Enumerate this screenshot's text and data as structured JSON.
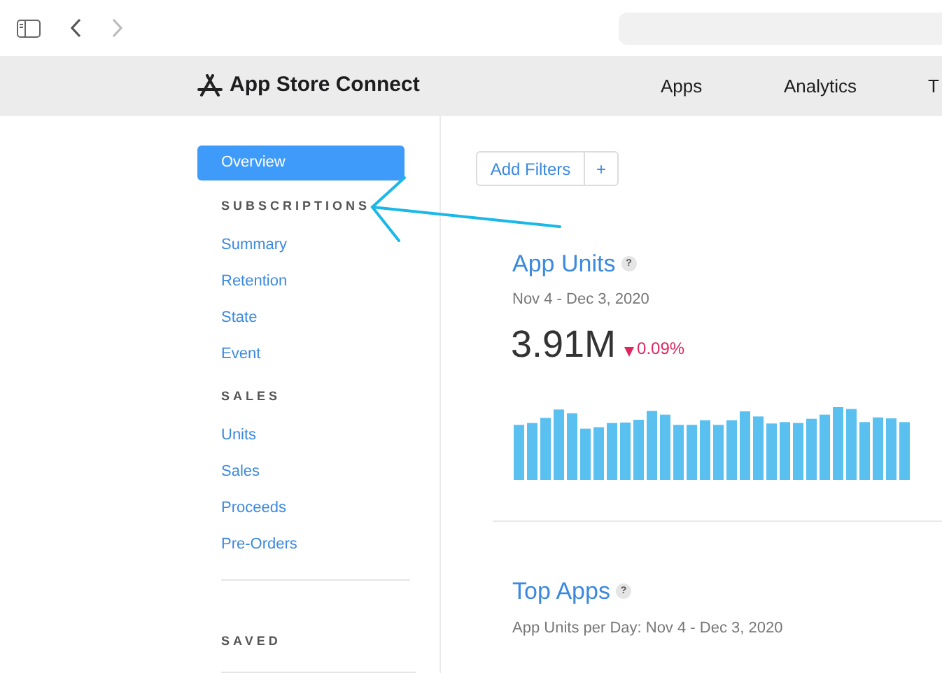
{
  "header": {
    "title": "App Store Connect",
    "nav": [
      {
        "label": "Apps"
      },
      {
        "label": "Analytics"
      },
      {
        "label": "T"
      }
    ]
  },
  "sidebar": {
    "overview": {
      "label": "Overview",
      "selected": true
    },
    "sections": [
      {
        "heading": "SUBSCRIPTIONS",
        "items": [
          "Summary",
          "Retention",
          "State",
          "Event"
        ]
      },
      {
        "heading": "SALES",
        "items": [
          "Units",
          "Sales",
          "Proceeds",
          "Pre-Orders"
        ]
      },
      {
        "heading": "SAVED"
      }
    ]
  },
  "filters": {
    "button": "Add Filters",
    "add": "+"
  },
  "app_units": {
    "title": "App Units",
    "help": "?",
    "date_range": "Nov 4 - Dec 3, 2020",
    "value": "3.91M",
    "change": "0.09%"
  },
  "top_apps": {
    "title": "Top Apps",
    "help": "?",
    "subtitle": "App Units per Day: Nov 4 - Dec 3, 2020"
  }
}
